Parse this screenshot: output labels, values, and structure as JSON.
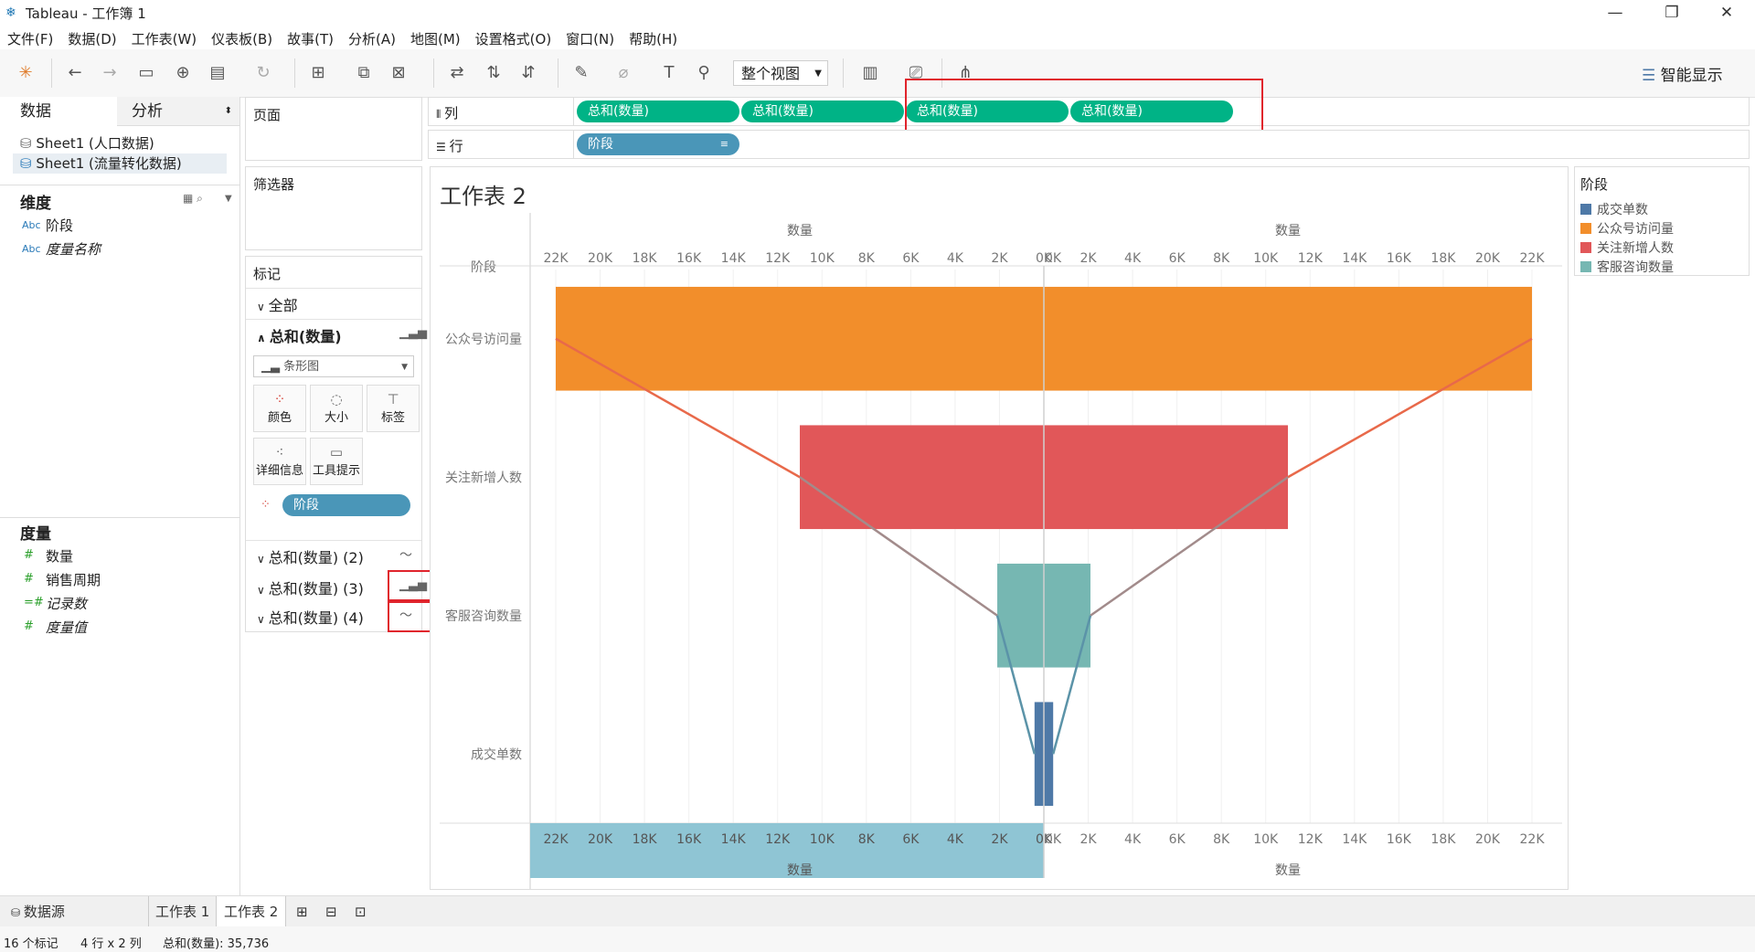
{
  "window": {
    "title": "Tableau - 工作簿 1"
  },
  "menu": [
    "文件(F)",
    "数据(D)",
    "工作表(W)",
    "仪表板(B)",
    "故事(T)",
    "分析(A)",
    "地图(M)",
    "设置格式(O)",
    "窗口(N)",
    "帮助(H)"
  ],
  "toolbar": {
    "view_select": "整个视图",
    "smart_show": "智能显示"
  },
  "left": {
    "tab_data": "数据",
    "tab_analysis": "分析",
    "sources": [
      "Sheet1 (人口数据)",
      "Sheet1 (流量转化数据)"
    ],
    "dimensions_header": "维度",
    "dimensions": [
      {
        "type": "Abc",
        "name": "阶段"
      },
      {
        "type": "Abc",
        "name": "度量名称"
      }
    ],
    "measures_header": "度量",
    "measures": [
      "数量",
      "销售周期",
      "记录数",
      "度量值"
    ]
  },
  "cards": {
    "pages": "页面",
    "filters": "筛选器",
    "marks": "标记",
    "all": "全部",
    "measure1": "总和(数量)",
    "marktype": "条形图",
    "buttons": [
      "颜色",
      "大小",
      "标签",
      "详细信息",
      "工具提示"
    ],
    "color_pill": "阶段",
    "measure2": "总和(数量) (2)",
    "measure3": "总和(数量) (3)",
    "measure4": "总和(数量) (4)"
  },
  "shelves": {
    "columns_label": "列",
    "rows_label": "行",
    "columns": [
      "总和(数量)",
      "总和(数量)",
      "总和(数量)",
      "总和(数量)"
    ],
    "rows": [
      "阶段"
    ]
  },
  "viz": {
    "title": "工作表 2",
    "axis_label": "数量",
    "row_header": "阶段"
  },
  "chart_data": {
    "type": "bar",
    "title": "工作表 2",
    "categories": [
      "公众号访问量",
      "关注新增人数",
      "客服咨询数量",
      "成交单数"
    ],
    "values": [
      22000,
      11000,
      2100,
      420
    ],
    "colors": [
      "#f28e2b",
      "#e15759",
      "#76b7b2",
      "#4e79a7"
    ],
    "xlim": [
      0,
      22000
    ],
    "ticks_left": [
      "22K",
      "20K",
      "18K",
      "16K",
      "14K",
      "12K",
      "10K",
      "8K",
      "6K",
      "4K",
      "2K",
      "0K"
    ],
    "ticks_right": [
      "0K",
      "2K",
      "4K",
      "6K",
      "8K",
      "10K",
      "12K",
      "14K",
      "16K",
      "18K",
      "20K",
      "22K"
    ],
    "xlabel": "数量",
    "ylabel": "阶段",
    "grid": true
  },
  "legend": {
    "title": "阶段",
    "items": [
      {
        "label": "成交单数",
        "color": "#4e79a7"
      },
      {
        "label": "公众号访问量",
        "color": "#f28e2b"
      },
      {
        "label": "关注新增人数",
        "color": "#e15759"
      },
      {
        "label": "客服咨询数量",
        "color": "#76b7b2"
      }
    ]
  },
  "tabs": {
    "datasource": "数据源",
    "sheet1": "工作表 1",
    "sheet2": "工作表 2"
  },
  "status": {
    "marks": "16 个标记",
    "rc": "4 行 x 2 列",
    "sum": "总和(数量): 35,736"
  }
}
